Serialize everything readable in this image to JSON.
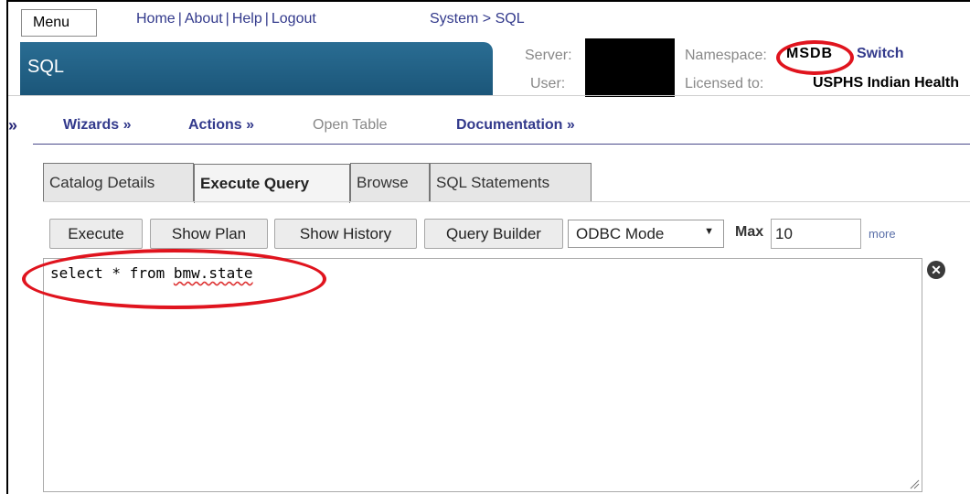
{
  "header": {
    "menu_label": "Menu",
    "links": [
      "Home",
      "About",
      "Help",
      "Logout"
    ],
    "link_separator": "|",
    "location": "System > SQL",
    "page_title": "SQL",
    "server_label": "Server:",
    "user_label": "User:",
    "namespace_label": "Namespace:",
    "namespace_value": "MSDB",
    "switch_label": "Switch",
    "licensed_label": "Licensed to:",
    "licensed_value": "USPHS Indian Health"
  },
  "nav": {
    "arrow": "»",
    "items": [
      {
        "label": "Wizards »"
      },
      {
        "label": "Actions »"
      },
      {
        "label": "Open Table"
      },
      {
        "label": "Documentation »"
      }
    ]
  },
  "tabs": [
    {
      "label": "Catalog Details",
      "active": false
    },
    {
      "label": "Execute Query",
      "active": true
    },
    {
      "label": "Browse",
      "active": false
    },
    {
      "label": "SQL Statements",
      "active": false
    }
  ],
  "toolbar": {
    "execute_label": "Execute",
    "show_plan_label": "Show Plan",
    "show_history_label": "Show History",
    "query_builder_label": "Query Builder",
    "mode_selected": "ODBC Mode",
    "max_label": "Max",
    "max_value": "10",
    "more_label": "more"
  },
  "editor": {
    "query_prefix": "select * from ",
    "query_table": "bmw.state"
  },
  "icons": {
    "clear": "close-circle-icon",
    "resize": "resize-grip-icon",
    "dropdown": "caret-down-icon"
  },
  "colors": {
    "title_bar": "#1b5679",
    "link": "#333a8c",
    "annotation": "#e0141e"
  }
}
